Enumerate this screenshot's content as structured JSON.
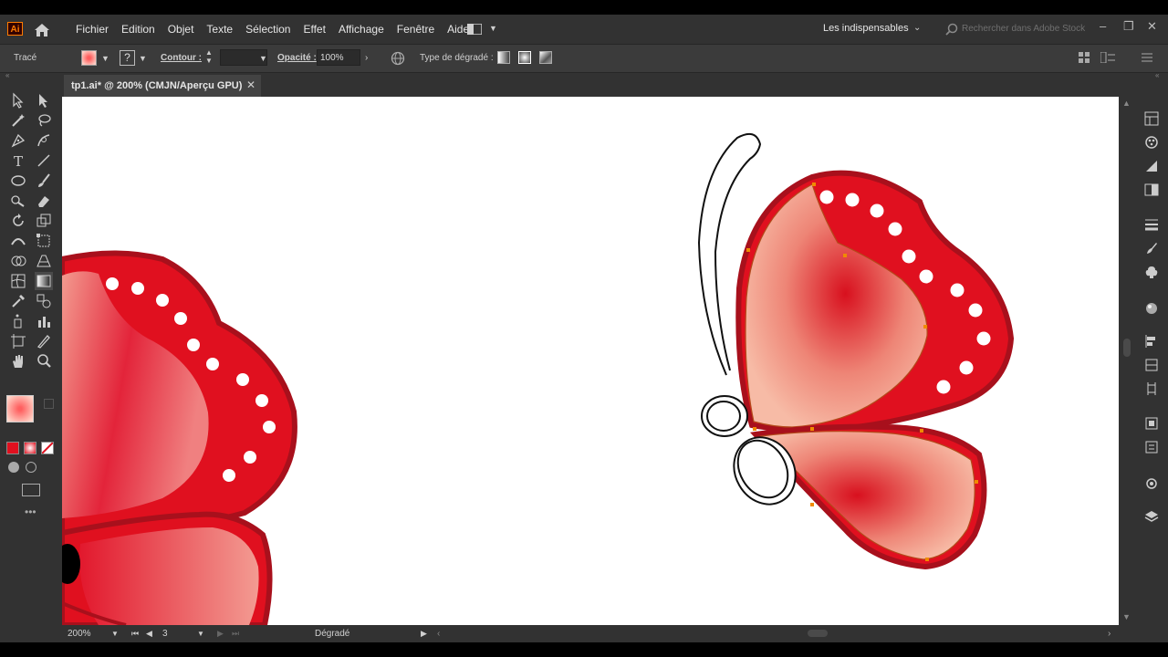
{
  "app": {
    "logo": "Ai",
    "menu": [
      "Fichier",
      "Edition",
      "Objet",
      "Texte",
      "Sélection",
      "Effet",
      "Affichage",
      "Fenêtre",
      "Aide"
    ],
    "workspace": "Les indispensables",
    "search_placeholder": "Rechercher dans Adobe Stock"
  },
  "control": {
    "selection_type": "Tracé",
    "stroke_label": "Contour :",
    "opacity_label": "Opacité :",
    "opacity_value": "100%",
    "gradient_type_label": "Type de dégradé :"
  },
  "document": {
    "tab_title": "tp1.ai* @ 200% (CMJN/Aperçu GPU)"
  },
  "status": {
    "zoom": "200%",
    "artboard": "3",
    "active_tool": "Dégradé"
  },
  "icons": [
    "home-icon",
    "workspace-icon",
    "search-icon",
    "minimize-icon",
    "restore-icon",
    "close-icon",
    "globe-icon",
    "selection-tool-icon",
    "pen-tool-icon",
    "type-tool-icon",
    "gradient-tool-icon",
    "hand-tool-icon",
    "zoom-tool-icon"
  ],
  "colors": {
    "accent_red": "#e0101f",
    "wing_outline": "#a8101c",
    "wing_light": "#f6b8a3",
    "ui_dark": "#323232"
  }
}
